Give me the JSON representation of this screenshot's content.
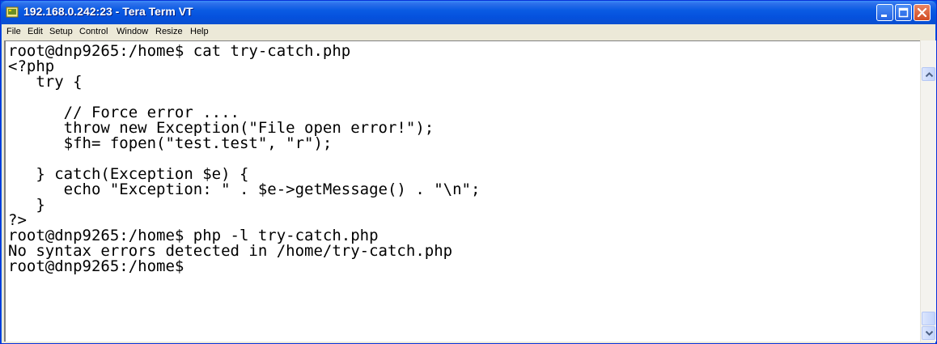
{
  "window": {
    "title": "192.168.0.242:23 - Tera Term VT",
    "icon": "tera-term-app-icon",
    "buttons": [
      "minimize-icon",
      "maximize-icon",
      "close-icon"
    ]
  },
  "menu": {
    "items": [
      "File",
      "Edit",
      "Setup",
      "Control",
      "Window",
      "Resize",
      "Help"
    ]
  },
  "terminal": {
    "lines": [
      "root@dnp9265:/home$ cat try-catch.php",
      "<?php",
      "   try {",
      "",
      "      // Force error ....",
      "      throw new Exception(\"File open error!\");",
      "      $fh= fopen(\"test.test\", \"r\");",
      "",
      "   } catch(Exception $e) {",
      "      echo \"Exception: \" . $e->getMessage() . \"\\n\";",
      "   }",
      "?>",
      "root@dnp9265:/home$ php -l try-catch.php",
      "No syntax errors detected in /home/try-catch.php",
      "root@dnp9265:/home$"
    ]
  },
  "scrollbar": {
    "up_icon": "scroll-up-arrow-icon",
    "down_icon": "scroll-down-arrow-icon"
  },
  "colors": {
    "titlebar": "#0054E3",
    "terminal_bg": "#FFFFFF",
    "terminal_fg": "#000000",
    "menubar": "#ECE9D8"
  }
}
